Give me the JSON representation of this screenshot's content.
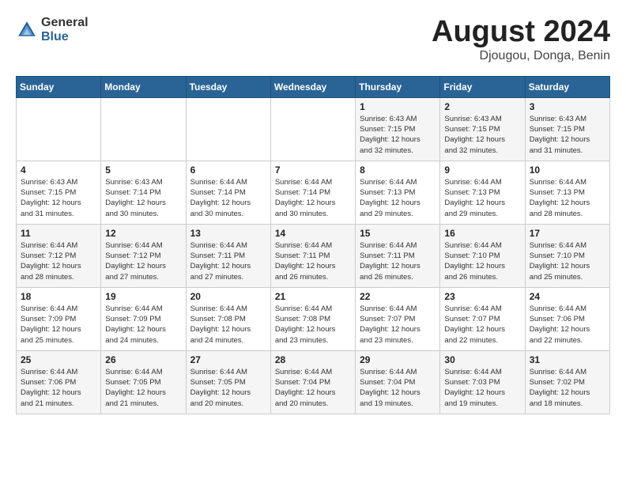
{
  "header": {
    "logo_general": "General",
    "logo_blue": "Blue",
    "month_title": "August 2024",
    "location": "Djougou, Donga, Benin"
  },
  "days_of_week": [
    "Sunday",
    "Monday",
    "Tuesday",
    "Wednesday",
    "Thursday",
    "Friday",
    "Saturday"
  ],
  "weeks": [
    [
      {
        "day": "",
        "info": ""
      },
      {
        "day": "",
        "info": ""
      },
      {
        "day": "",
        "info": ""
      },
      {
        "day": "",
        "info": ""
      },
      {
        "day": "1",
        "info": "Sunrise: 6:43 AM\nSunset: 7:15 PM\nDaylight: 12 hours\nand 32 minutes."
      },
      {
        "day": "2",
        "info": "Sunrise: 6:43 AM\nSunset: 7:15 PM\nDaylight: 12 hours\nand 32 minutes."
      },
      {
        "day": "3",
        "info": "Sunrise: 6:43 AM\nSunset: 7:15 PM\nDaylight: 12 hours\nand 31 minutes."
      }
    ],
    [
      {
        "day": "4",
        "info": "Sunrise: 6:43 AM\nSunset: 7:15 PM\nDaylight: 12 hours\nand 31 minutes."
      },
      {
        "day": "5",
        "info": "Sunrise: 6:43 AM\nSunset: 7:14 PM\nDaylight: 12 hours\nand 30 minutes."
      },
      {
        "day": "6",
        "info": "Sunrise: 6:44 AM\nSunset: 7:14 PM\nDaylight: 12 hours\nand 30 minutes."
      },
      {
        "day": "7",
        "info": "Sunrise: 6:44 AM\nSunset: 7:14 PM\nDaylight: 12 hours\nand 30 minutes."
      },
      {
        "day": "8",
        "info": "Sunrise: 6:44 AM\nSunset: 7:13 PM\nDaylight: 12 hours\nand 29 minutes."
      },
      {
        "day": "9",
        "info": "Sunrise: 6:44 AM\nSunset: 7:13 PM\nDaylight: 12 hours\nand 29 minutes."
      },
      {
        "day": "10",
        "info": "Sunrise: 6:44 AM\nSunset: 7:13 PM\nDaylight: 12 hours\nand 28 minutes."
      }
    ],
    [
      {
        "day": "11",
        "info": "Sunrise: 6:44 AM\nSunset: 7:12 PM\nDaylight: 12 hours\nand 28 minutes."
      },
      {
        "day": "12",
        "info": "Sunrise: 6:44 AM\nSunset: 7:12 PM\nDaylight: 12 hours\nand 27 minutes."
      },
      {
        "day": "13",
        "info": "Sunrise: 6:44 AM\nSunset: 7:11 PM\nDaylight: 12 hours\nand 27 minutes."
      },
      {
        "day": "14",
        "info": "Sunrise: 6:44 AM\nSunset: 7:11 PM\nDaylight: 12 hours\nand 26 minutes."
      },
      {
        "day": "15",
        "info": "Sunrise: 6:44 AM\nSunset: 7:11 PM\nDaylight: 12 hours\nand 26 minutes."
      },
      {
        "day": "16",
        "info": "Sunrise: 6:44 AM\nSunset: 7:10 PM\nDaylight: 12 hours\nand 26 minutes."
      },
      {
        "day": "17",
        "info": "Sunrise: 6:44 AM\nSunset: 7:10 PM\nDaylight: 12 hours\nand 25 minutes."
      }
    ],
    [
      {
        "day": "18",
        "info": "Sunrise: 6:44 AM\nSunset: 7:09 PM\nDaylight: 12 hours\nand 25 minutes."
      },
      {
        "day": "19",
        "info": "Sunrise: 6:44 AM\nSunset: 7:09 PM\nDaylight: 12 hours\nand 24 minutes."
      },
      {
        "day": "20",
        "info": "Sunrise: 6:44 AM\nSunset: 7:08 PM\nDaylight: 12 hours\nand 24 minutes."
      },
      {
        "day": "21",
        "info": "Sunrise: 6:44 AM\nSunset: 7:08 PM\nDaylight: 12 hours\nand 23 minutes."
      },
      {
        "day": "22",
        "info": "Sunrise: 6:44 AM\nSunset: 7:07 PM\nDaylight: 12 hours\nand 23 minutes."
      },
      {
        "day": "23",
        "info": "Sunrise: 6:44 AM\nSunset: 7:07 PM\nDaylight: 12 hours\nand 22 minutes."
      },
      {
        "day": "24",
        "info": "Sunrise: 6:44 AM\nSunset: 7:06 PM\nDaylight: 12 hours\nand 22 minutes."
      }
    ],
    [
      {
        "day": "25",
        "info": "Sunrise: 6:44 AM\nSunset: 7:06 PM\nDaylight: 12 hours\nand 21 minutes."
      },
      {
        "day": "26",
        "info": "Sunrise: 6:44 AM\nSunset: 7:05 PM\nDaylight: 12 hours\nand 21 minutes."
      },
      {
        "day": "27",
        "info": "Sunrise: 6:44 AM\nSunset: 7:05 PM\nDaylight: 12 hours\nand 20 minutes."
      },
      {
        "day": "28",
        "info": "Sunrise: 6:44 AM\nSunset: 7:04 PM\nDaylight: 12 hours\nand 20 minutes."
      },
      {
        "day": "29",
        "info": "Sunrise: 6:44 AM\nSunset: 7:04 PM\nDaylight: 12 hours\nand 19 minutes."
      },
      {
        "day": "30",
        "info": "Sunrise: 6:44 AM\nSunset: 7:03 PM\nDaylight: 12 hours\nand 19 minutes."
      },
      {
        "day": "31",
        "info": "Sunrise: 6:44 AM\nSunset: 7:02 PM\nDaylight: 12 hours\nand 18 minutes."
      }
    ]
  ]
}
